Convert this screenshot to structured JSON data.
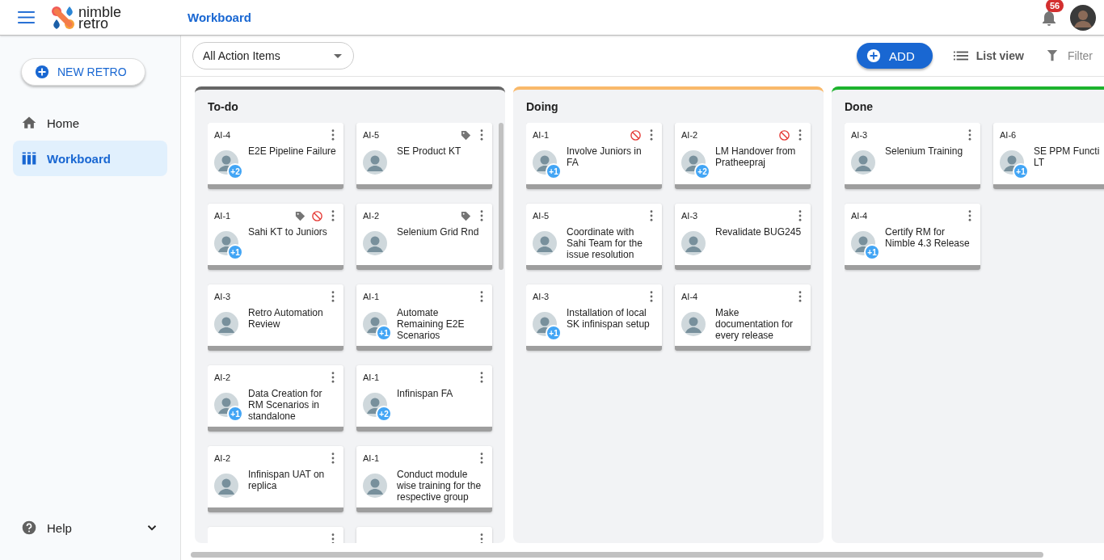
{
  "header": {
    "logo_top": "nimble",
    "logo_bottom": "retro",
    "title": "Workboard",
    "notifications": "56"
  },
  "sidebar": {
    "new_button": "NEW RETRO",
    "items": [
      {
        "label": "Home",
        "selected": false
      },
      {
        "label": "Workboard",
        "selected": true
      }
    ],
    "help": "Help"
  },
  "toolbar": {
    "dropdown": "All Action Items",
    "add": "ADD",
    "list_view": "List view",
    "filter": "Filter"
  },
  "columns": [
    {
      "title": "To-do",
      "color": "#666666",
      "cards": [
        {
          "kind": "card",
          "id": "AI-4",
          "title": "E2E Pipeline Failure",
          "extra": "+2",
          "tag": false,
          "blocked": false
        },
        {
          "kind": "card",
          "id": "AI-5",
          "title": "SE Product KT",
          "tag": true,
          "blocked": false
        },
        {
          "kind": "card",
          "id": "AI-1",
          "title": "Sahi KT to Juniors",
          "extra": "+1",
          "tag": true,
          "blocked": true
        },
        {
          "kind": "card",
          "id": "AI-2",
          "title": "Selenium Grid Rnd",
          "tag": true,
          "blocked": false
        },
        {
          "kind": "card",
          "id": "AI-3",
          "title": "Retro Automation Review",
          "tag": false,
          "blocked": false
        },
        {
          "kind": "card",
          "id": "AI-1",
          "title": "Automate Remaining E2E Scenarios",
          "extra": "+1",
          "tag": false,
          "blocked": false
        },
        {
          "kind": "card",
          "id": "AI-2",
          "title": "Data Creation for RM Scenarios in standalone",
          "extra": "+1",
          "tag": false,
          "blocked": false
        },
        {
          "kind": "card",
          "id": "AI-1",
          "title": "Infinispan FA",
          "extra": "+2",
          "tag": false,
          "blocked": false
        },
        {
          "kind": "card",
          "id": "AI-2",
          "title": "Infinispan UAT on replica",
          "tag": false,
          "blocked": false
        },
        {
          "kind": "card",
          "id": "AI-1",
          "title": "Conduct module wise training for the respective group",
          "tag": false,
          "blocked": false
        },
        {
          "kind": "clipped"
        },
        {
          "kind": "clipped"
        }
      ]
    },
    {
      "title": "Doing",
      "color": "#f9b96a",
      "cards": [
        {
          "kind": "card",
          "id": "AI-1",
          "title": "Involve Juniors in FA",
          "extra": "+1",
          "tag": false,
          "blocked": true
        },
        {
          "kind": "card",
          "id": "AI-2",
          "title": "LM Handover from Pratheepraj",
          "extra": "+2",
          "tag": false,
          "blocked": true
        },
        {
          "kind": "card",
          "id": "AI-5",
          "title": "Coordinate with Sahi Team for the issue resolution",
          "tag": false,
          "blocked": false
        },
        {
          "kind": "card",
          "id": "AI-3",
          "title": "Revalidate BUG245",
          "tag": false,
          "blocked": false
        },
        {
          "kind": "card",
          "id": "AI-3",
          "title": "Installation of local SK infinispan setup",
          "extra": "+1",
          "tag": false,
          "blocked": false
        },
        {
          "kind": "card",
          "id": "AI-4",
          "title": "Make documentation for every release",
          "tag": false,
          "blocked": false
        }
      ]
    },
    {
      "title": "Done",
      "color": "#1db32e",
      "cards": [
        {
          "kind": "card",
          "id": "AI-3",
          "title": "Selenium Training",
          "tag": false,
          "blocked": false
        },
        {
          "kind": "card",
          "id": "AI-6",
          "title": "SE PPM Functi\nLT",
          "extra": "+1",
          "tag": false,
          "blocked": false
        },
        {
          "kind": "card",
          "id": "AI-4",
          "title": "Certify RM for Nimble 4.3 Release",
          "extra": "+1",
          "tag": false,
          "blocked": false
        }
      ]
    }
  ]
}
